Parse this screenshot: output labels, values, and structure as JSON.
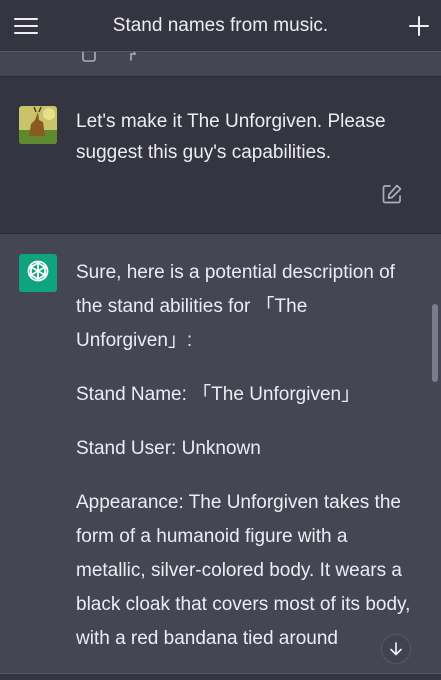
{
  "header": {
    "title": "Stand names from music."
  },
  "user_message": {
    "text": "Let's make it The Unforgiven. Please suggest this guy's capabilities."
  },
  "assistant_message": {
    "paragraphs": [
      "Sure, here is a potential description of the stand abilities for 「The Unforgiven」:",
      "Stand Name: 「The Unforgiven」",
      "Stand User: Unknown",
      "Appearance: The Unforgiven takes the form of a humanoid figure with a metallic, silver-colored body. It wears a black cloak that covers most of its body, with a red bandana tied around"
    ]
  },
  "colors": {
    "header_bg": "#343541",
    "user_bg": "#343541",
    "assistant_bg": "#444654",
    "assistant_avatar": "#10a37f",
    "text": "#ececf1"
  },
  "icons": {
    "menu": "hamburger-menu-icon",
    "new_chat": "plus-icon",
    "edit": "edit-icon",
    "assistant": "openai-logo-icon",
    "scroll_down": "arrow-down-icon"
  }
}
